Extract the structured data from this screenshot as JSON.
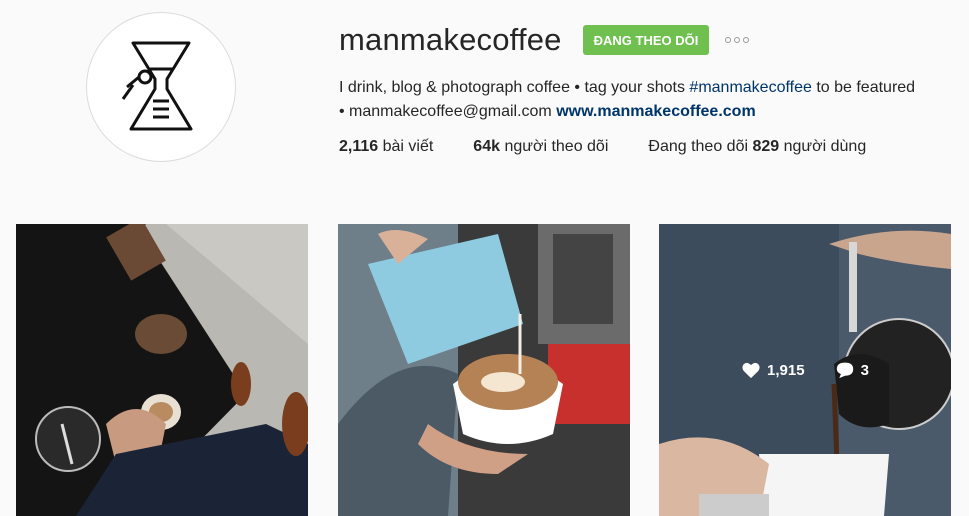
{
  "profile": {
    "username": "manmakecoffee",
    "follow_label": "ĐANG THEO DÕI",
    "bio_line1_a": "I drink, blog & photograph coffee • tag your shots ",
    "bio_hashtag": "#manmakecoffee",
    "bio_line1_b": " to be featured",
    "bio_line2_a": "• manmakecoffee@gmail.com ",
    "bio_link": "www.manmakecoffee.com"
  },
  "stats": {
    "posts_count": "2,116",
    "posts_label": " bài viết",
    "followers_count": "64k",
    "followers_label": " người theo dõi",
    "following_prefix": "Đang theo dõi ",
    "following_count": "829",
    "following_label": " người dùng"
  },
  "posts": [
    {
      "description": "coffee-cup-on-table"
    },
    {
      "description": "latte-art-pour"
    },
    {
      "description": "siphon-coffee-pour",
      "likes": "1,915",
      "comments": "3"
    }
  ],
  "colors": {
    "follow_button": "#70c050",
    "link": "#003569"
  }
}
